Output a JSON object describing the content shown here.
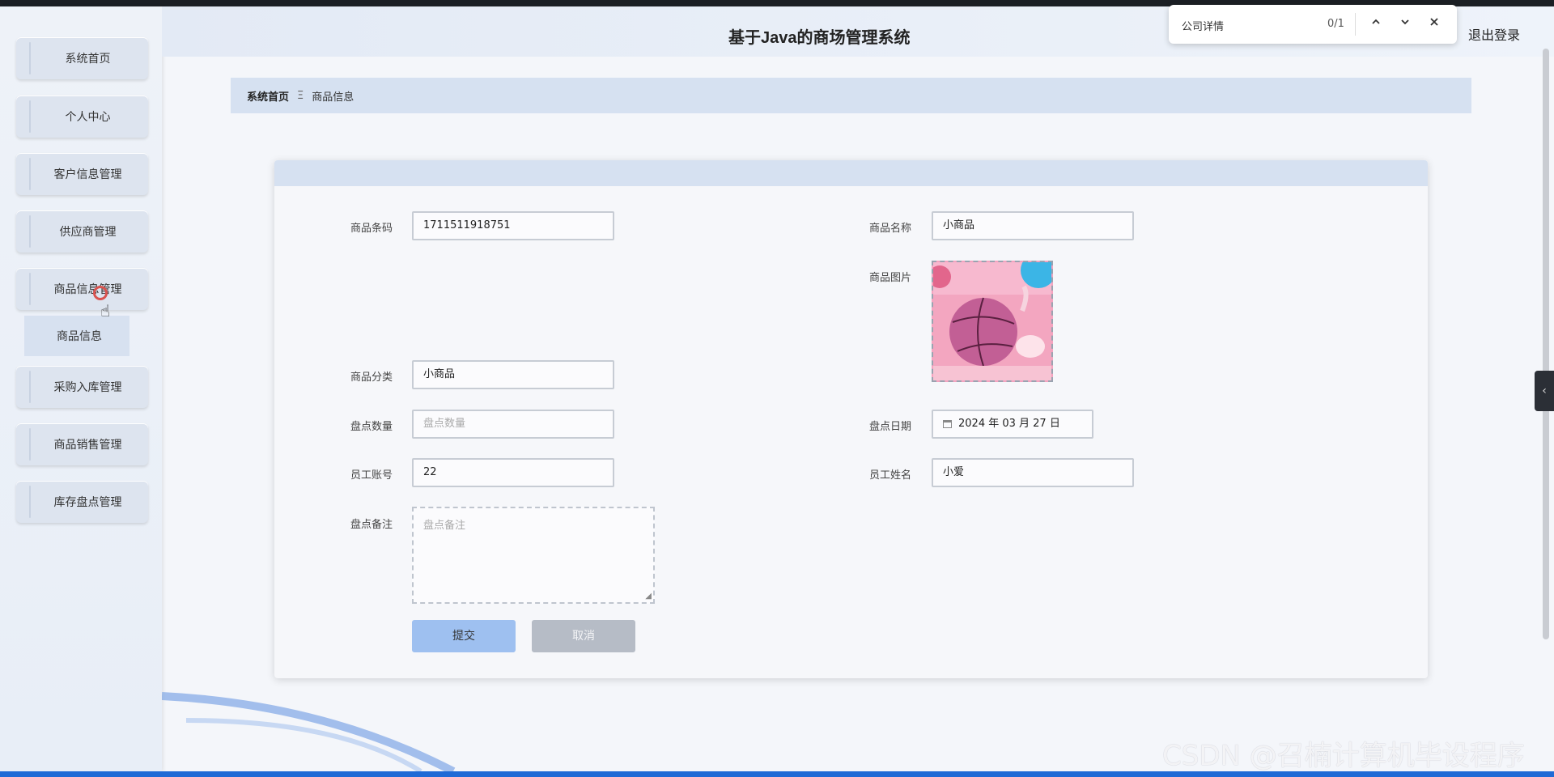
{
  "header": {
    "title": "基于Java的商场管理系统",
    "logout_label": "退出登录"
  },
  "findbar": {
    "query": "公司详情",
    "count": "0/1",
    "prev_icon": "chevron-up-icon",
    "next_icon": "chevron-down-icon",
    "close_icon": "close-icon"
  },
  "sidebar": {
    "items": [
      {
        "label": "系统首页"
      },
      {
        "label": "个人中心"
      },
      {
        "label": "客户信息管理"
      },
      {
        "label": "供应商管理"
      },
      {
        "label": "商品信息管理"
      },
      {
        "label": "采购入库管理"
      },
      {
        "label": "商品销售管理"
      },
      {
        "label": "库存盘点管理"
      }
    ],
    "submenu_label": "商品信息"
  },
  "breadcrumb": {
    "home": "系统首页",
    "separator": "Ξ",
    "current": "商品信息"
  },
  "form": {
    "barcode_label": "商品条码",
    "barcode_value": "1711511918751",
    "name_label": "商品名称",
    "name_value": "小商品",
    "image_label": "商品图片",
    "category_label": "商品分类",
    "category_value": "小商品",
    "stock_count_label": "盘点数量",
    "stock_count_placeholder": "盘点数量",
    "stock_date_label": "盘点日期",
    "stock_date_value": "2024 年 03 月 27 日",
    "employee_account_label": "员工账号",
    "employee_account_value": "22",
    "employee_name_label": "员工姓名",
    "employee_name_value": "小爱",
    "remark_label": "盘点备注",
    "remark_placeholder": "盘点备注",
    "submit_label": "提交",
    "cancel_label": "取消"
  },
  "watermark": "CSDN @召楠计算机毕设程序"
}
